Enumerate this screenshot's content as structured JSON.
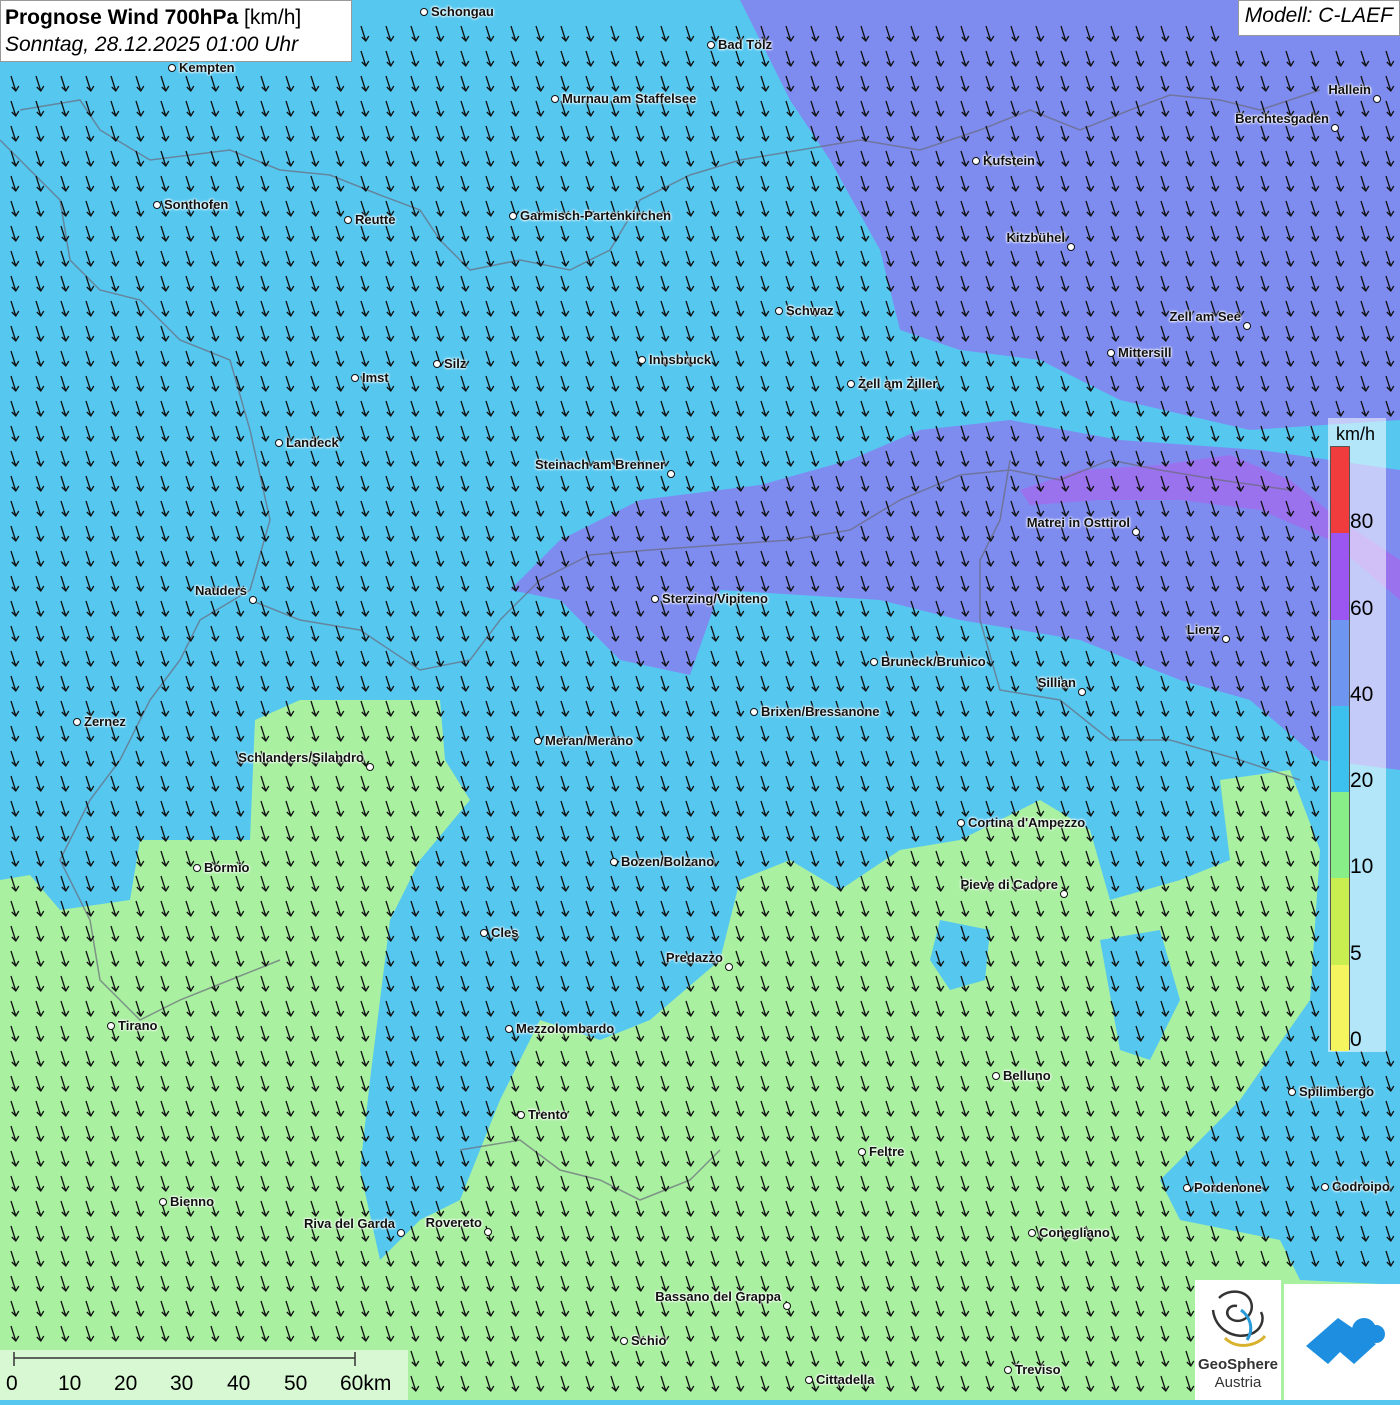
{
  "title": {
    "bold": "Prognose Wind 700hPa",
    "unit": "[km/h]",
    "date": "Sonntag, 28.12.2025 01:00 Uhr"
  },
  "model": "Modell: C-LAEF",
  "legend": {
    "unit": "km/h",
    "ticks": [
      "80",
      "60",
      "40",
      "20",
      "10",
      "5",
      "0"
    ],
    "colors": [
      "#f03c3c",
      "#9b55f0",
      "#6e96f0",
      "#3cc0ee",
      "#88ee88",
      "#c8ee50",
      "#f5f560"
    ]
  },
  "scalebar": {
    "labels": [
      "0",
      "10",
      "20",
      "30",
      "40",
      "50",
      "60km"
    ]
  },
  "logo": {
    "name": "GeoSphere",
    "sub": "Austria"
  },
  "colors": {
    "field_strong": "#7e8cf0",
    "field_violet": "#9a72ee",
    "field_mid": "#56c8f0",
    "field_weak": "#a9f0a0",
    "arrow": "#111111"
  },
  "cities": [
    {
      "name": "Schongau",
      "label_side": "right"
    },
    {
      "name": "Bad Tölz",
      "label_side": "right"
    },
    {
      "name": "Kempten",
      "label_side": "right"
    },
    {
      "name": "Murnau am Staffelsee",
      "label_side": "right"
    },
    {
      "name": "Hallein",
      "label_side": "left"
    },
    {
      "name": "Berchtesgaden",
      "label_side": "left"
    },
    {
      "name": "Kufstein",
      "label_side": "right"
    },
    {
      "name": "Sonthofen",
      "label_side": "right"
    },
    {
      "name": "Reutte",
      "label_side": "right"
    },
    {
      "name": "Garmisch-Partenkirchen",
      "label_side": "right"
    },
    {
      "name": "Kitzbühel",
      "label_side": "left"
    },
    {
      "name": "Schwaz",
      "label_side": "right"
    },
    {
      "name": "Zell am See",
      "label_side": "left"
    },
    {
      "name": "Mittersill",
      "label_side": "right"
    },
    {
      "name": "Innsbruck",
      "label_side": "right"
    },
    {
      "name": "Silz",
      "label_side": "right"
    },
    {
      "name": "Imst",
      "label_side": "right"
    },
    {
      "name": "Zell am Ziller",
      "label_side": "right"
    },
    {
      "name": "Landeck",
      "label_side": "right"
    },
    {
      "name": "Steinach am Brenner",
      "label_side": "left"
    },
    {
      "name": "Matrei in Osttirol",
      "label_side": "left"
    },
    {
      "name": "Nauders",
      "label_side": "left"
    },
    {
      "name": "Sterzing/Vipiteno",
      "label_side": "right"
    },
    {
      "name": "Lienz",
      "label_side": "left"
    },
    {
      "name": "Bruneck/Brunico",
      "label_side": "right"
    },
    {
      "name": "Sillian",
      "label_side": "left"
    },
    {
      "name": "Brixen/Bressanone",
      "label_side": "right"
    },
    {
      "name": "Zernez",
      "label_side": "right"
    },
    {
      "name": "Meran/Merano",
      "label_side": "right"
    },
    {
      "name": "Schlanders/Silandro",
      "label_side": "left"
    },
    {
      "name": "Cortina d'Ampezzo",
      "label_side": "right"
    },
    {
      "name": "Bozen/Bolzano",
      "label_side": "right"
    },
    {
      "name": "Bormio",
      "label_side": "right"
    },
    {
      "name": "Pieve di Cadore",
      "label_side": "left"
    },
    {
      "name": "Cles",
      "label_side": "right"
    },
    {
      "name": "Predazzo",
      "label_side": "left"
    },
    {
      "name": "Tirano",
      "label_side": "right"
    },
    {
      "name": "Mezzolombardo",
      "label_side": "right"
    },
    {
      "name": "Belluno",
      "label_side": "right"
    },
    {
      "name": "Spilimbergo",
      "label_side": "right"
    },
    {
      "name": "Trento",
      "label_side": "right"
    },
    {
      "name": "Feltre",
      "label_side": "right"
    },
    {
      "name": "Pordenone",
      "label_side": "right"
    },
    {
      "name": "Codroipo",
      "label_side": "right"
    },
    {
      "name": "Bienno",
      "label_side": "right"
    },
    {
      "name": "Riva del Garda",
      "label_side": "left"
    },
    {
      "name": "Rovereto",
      "label_side": "left"
    },
    {
      "name": "Conegliano",
      "label_side": "right"
    },
    {
      "name": "Bassano del Grappa",
      "label_side": "left"
    },
    {
      "name": "Schio",
      "label_side": "right"
    },
    {
      "name": "Treviso",
      "label_side": "right"
    },
    {
      "name": "Cittadella",
      "label_side": "right"
    }
  ]
}
